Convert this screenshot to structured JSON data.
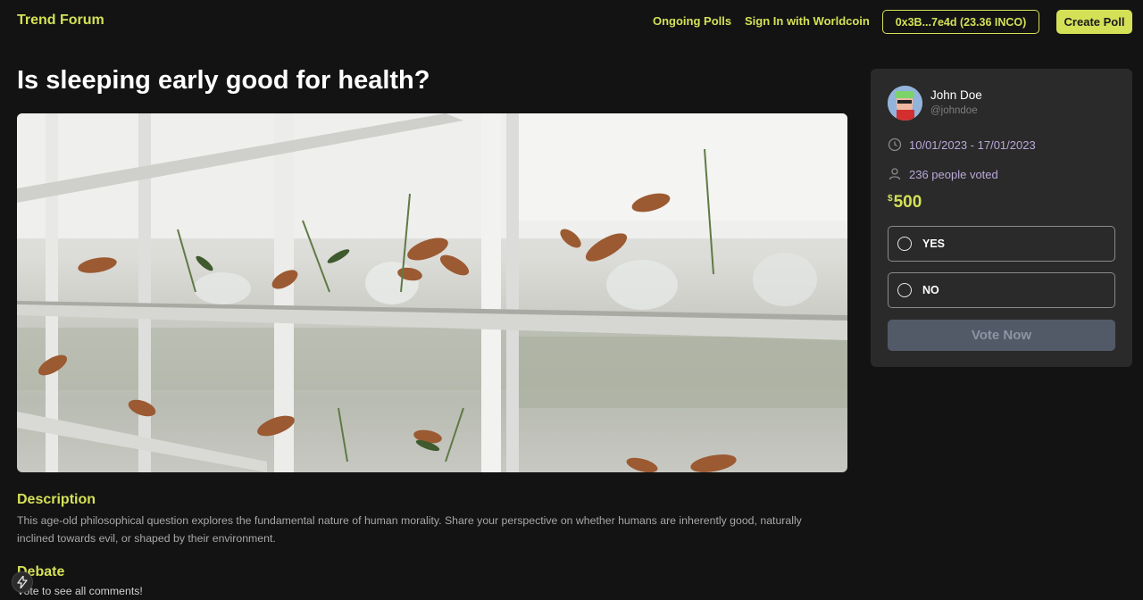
{
  "header": {
    "brand": "Trend Forum",
    "nav": [
      "Ongoing Polls",
      "Sign In with Worldcoin"
    ],
    "wallet": "0x3B...7e4d (23.36 INCO)",
    "create_button": "Create Poll"
  },
  "poll": {
    "title": "Is sleeping early good for health?",
    "description_heading": "Description",
    "description": "This age-old philosophical question explores the fundamental nature of human morality. Share your perspective on whether humans are inherently good, naturally inclined towards evil, or shaped by their environment.",
    "debate_heading": "Debate",
    "debate_text": "Vote to see all comments!"
  },
  "sidebar": {
    "user_name": "John Doe",
    "user_handle": "@johndoe",
    "date_range": "10/01/2023 - 17/01/2023",
    "votes": "236 people voted",
    "prize_currency": "$",
    "prize_amount": "500",
    "options": [
      "YES",
      "NO"
    ],
    "vote_button": "Vote Now"
  },
  "icons": {
    "clock": "clock-icon",
    "user": "user-icon",
    "bolt": "bolt-icon"
  },
  "colors": {
    "accent": "#d4e157",
    "background": "#131313",
    "card": "#2a2a2a",
    "meta_text": "#b9a9d9",
    "vote_button": "#525a68"
  }
}
